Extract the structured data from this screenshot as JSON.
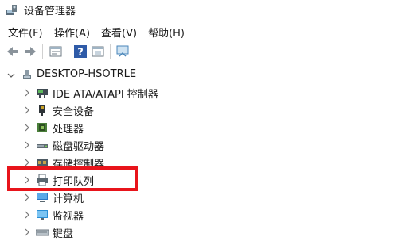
{
  "window": {
    "title": "设备管理器",
    "icon": "device-manager-icon"
  },
  "menu": [
    {
      "label": "文件(F)"
    },
    {
      "label": "操作(A)"
    },
    {
      "label": "查看(V)"
    },
    {
      "label": "帮助(H)"
    }
  ],
  "toolbar": {
    "buttons": [
      "back-arrow-icon",
      "forward-arrow-icon",
      "properties-icon",
      "help-icon",
      "view-icon",
      "monitor-icon"
    ]
  },
  "tree": {
    "root": {
      "label": "DESKTOP-HSOTRLE",
      "expanded": true,
      "icon": "computer-tower-icon"
    },
    "items": [
      {
        "label": "IDE ATA/ATAPI 控制器",
        "icon": "ide-controller-icon"
      },
      {
        "label": "安全设备",
        "icon": "security-device-icon"
      },
      {
        "label": "处理器",
        "icon": "processor-icon"
      },
      {
        "label": "磁盘驱动器",
        "icon": "disk-drive-icon"
      },
      {
        "label": "存储控制器",
        "icon": "storage-controller-icon"
      },
      {
        "label": "打印队列",
        "icon": "printer-icon"
      },
      {
        "label": "计算机",
        "icon": "computer-icon"
      },
      {
        "label": "监视器",
        "icon": "monitor-icon"
      },
      {
        "label": "键盘",
        "icon": "keyboard-icon"
      }
    ]
  },
  "colors": {
    "highlight": "#e8141b"
  }
}
